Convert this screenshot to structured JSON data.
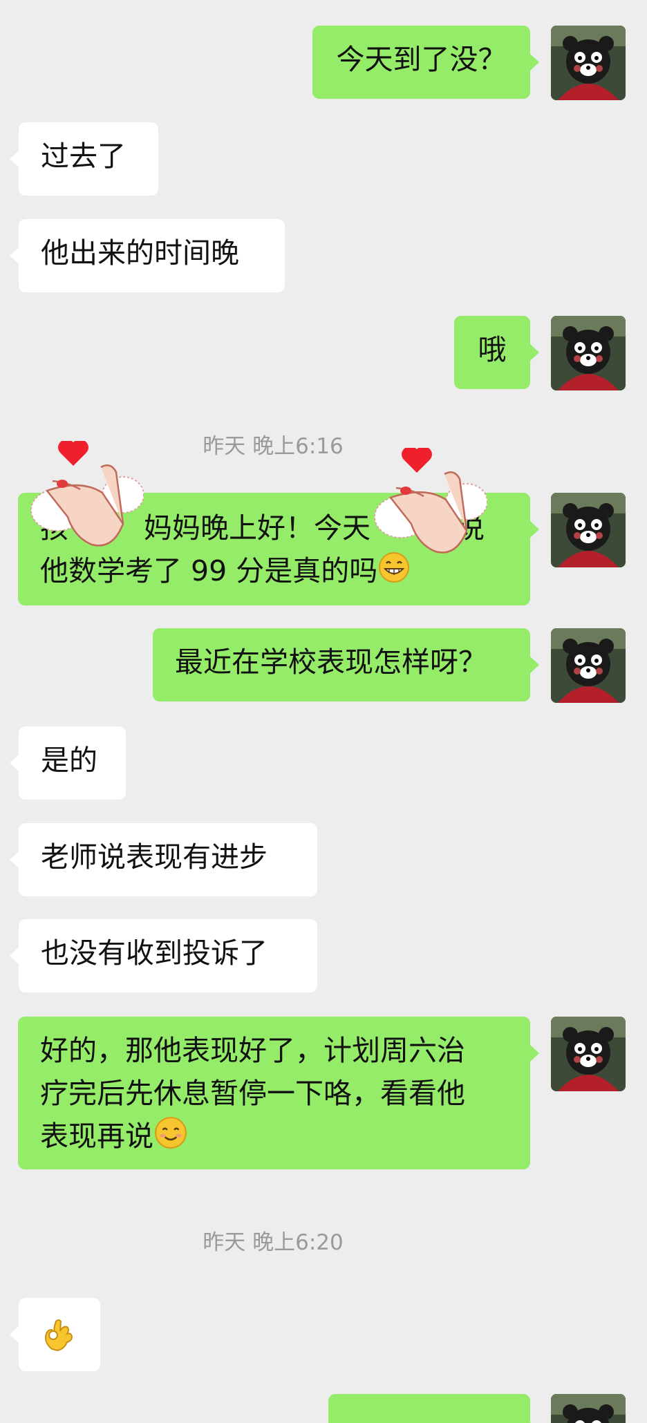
{
  "chat": {
    "messages": [
      {
        "id": "m1",
        "side": "sent",
        "text": "今天到了没？"
      },
      {
        "id": "m2",
        "side": "received",
        "text": "过去了"
      },
      {
        "id": "m3",
        "side": "received",
        "text": "他出来的时间晚"
      },
      {
        "id": "m4",
        "side": "sent",
        "text": "哦"
      },
      {
        "id": "t1",
        "type": "timestamp",
        "text": "昨天 晚上6:16"
      },
      {
        "id": "m5",
        "side": "sent",
        "line1_a": "孩",
        "line1_b": "妈妈晚上好！今天",
        "line1_c": "说",
        "line2": "他数学考了 99 分是真的吗",
        "emoji": "grin-emoji",
        "stickers": "finger-heart-sticker"
      },
      {
        "id": "m6",
        "side": "sent",
        "text": "最近在学校表现怎样呀？"
      },
      {
        "id": "m7",
        "side": "received",
        "text": "是的"
      },
      {
        "id": "m8",
        "side": "received",
        "text": "老师说表现有进步"
      },
      {
        "id": "m9",
        "side": "received",
        "text": "也没有收到投诉了"
      },
      {
        "id": "m10",
        "side": "sent",
        "line1": "好的，那他表现好了，计划周六治",
        "line2": "疗完后先休息暂停一下咯，看看他",
        "line3": "表现再说",
        "emoji": "smile-emoji"
      },
      {
        "id": "t2",
        "type": "timestamp",
        "text": "昨天 晚上6:20"
      },
      {
        "id": "m11",
        "side": "received",
        "emoji": "ok-hand-emoji"
      },
      {
        "id": "m12",
        "side": "sent",
        "partial": true
      }
    ]
  },
  "colors": {
    "background": "#ededed",
    "sent_bubble": "#95ec69",
    "received_bubble": "#ffffff",
    "timestamp_text": "#9a9a9a"
  },
  "avatar": {
    "icon": "bear-avatar-icon"
  }
}
